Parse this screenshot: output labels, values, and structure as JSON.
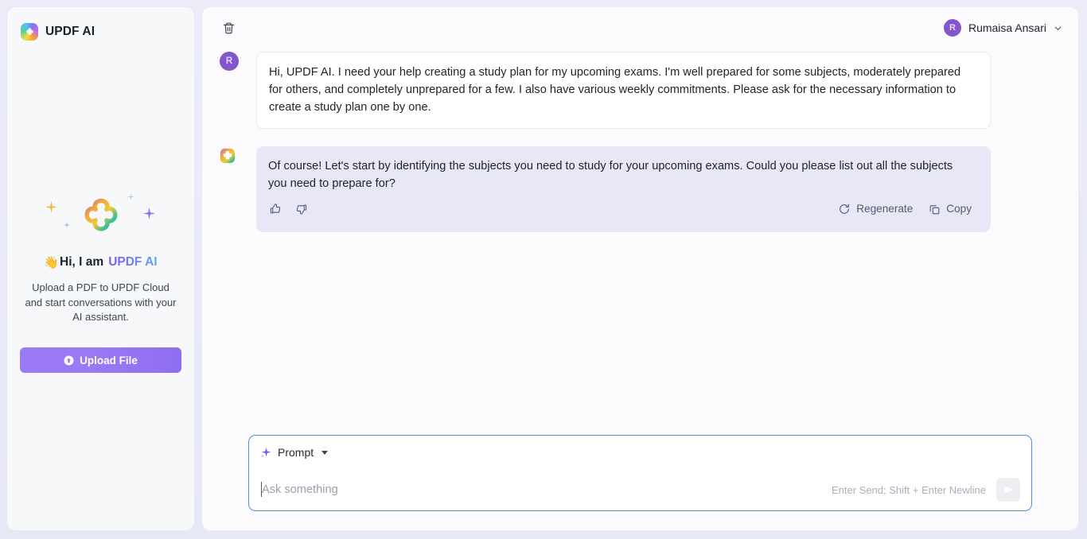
{
  "app": {
    "brand": "UPDF AI",
    "logo_icon": "updf-clover-logo"
  },
  "sidebar": {
    "title": "UPDF AI",
    "hero": {
      "wave_emoji": "👋",
      "greeting": "Hi, I am ",
      "brand": "UPDF AI",
      "description": "Upload a PDF to UPDF Cloud and start conversations with your AI assistant.",
      "art_icon": "updf-clover-logo-large"
    },
    "upload_button": {
      "label": "Upload File",
      "icon": "upload-circle-icon",
      "color": "#9a7af4"
    }
  },
  "topbar": {
    "delete_icon": "trash-icon",
    "user": {
      "initial": "R",
      "name": "Rumaisa Ansari",
      "avatar_color": "#8357cc",
      "caret_icon": "chevron-down-icon"
    }
  },
  "chat": {
    "messages": [
      {
        "role": "user",
        "avatar_initial": "R",
        "text": "Hi, UPDF AI. I need your help creating a study plan for my upcoming exams. I'm well prepared for some subjects, moderately prepared for others, and completely unprepared for a few. I also have various weekly commitments. Please ask for the necessary information to create a study plan one by one."
      },
      {
        "role": "assistant",
        "avatar_icon": "updf-clover-logo",
        "text": "Of course! Let's start by identifying the subjects you need to study for your upcoming exams. Could you please list out all the subjects you need to prepare for?",
        "actions": {
          "like_icon": "thumbs-up-icon",
          "dislike_icon": "thumbs-down-icon",
          "regenerate_label": "Regenerate",
          "regenerate_icon": "refresh-icon",
          "copy_label": "Copy",
          "copy_icon": "copy-icon"
        }
      }
    ]
  },
  "composer": {
    "prompt_chip": {
      "label": "Prompt",
      "icon": "sparkle-icon",
      "caret_icon": "caret-down-icon"
    },
    "input_placeholder": "Ask something",
    "input_value": "",
    "hint": "Enter Send; Shift + Enter Newline",
    "send_icon": "send-plane-icon",
    "border_color": "#4a90e2"
  }
}
